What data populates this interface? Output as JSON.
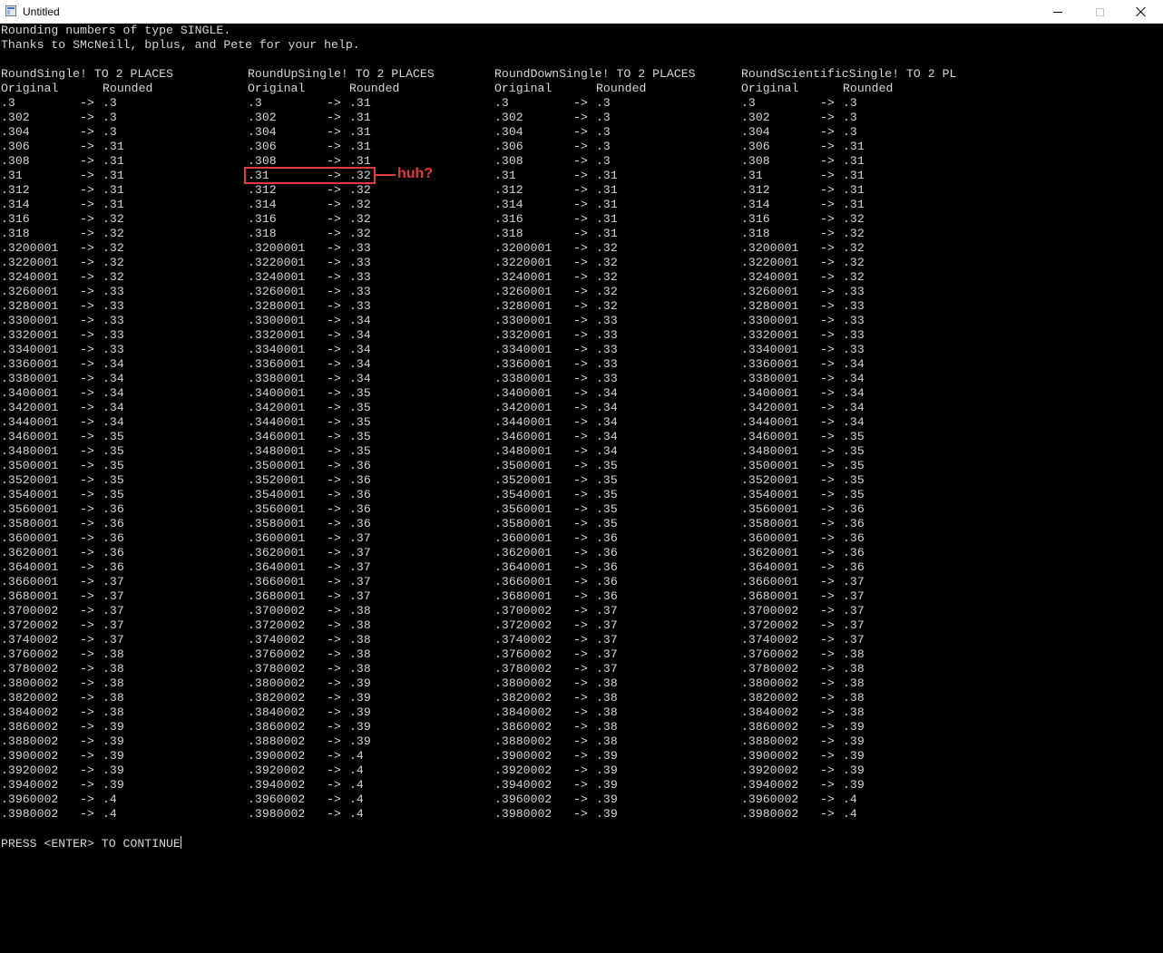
{
  "window": {
    "title": "Untitled"
  },
  "console": {
    "intro": [
      "Rounding numbers of type SINGLE.",
      "Thanks to SMcNeill, bplus, and Pete for your help."
    ],
    "columns": [
      {
        "header": "RoundSingle! TO 2 PLACES",
        "orig_label": "Original",
        "round_label": "Rounded",
        "rounded": [
          ".3",
          ".3",
          ".3",
          ".31",
          ".31",
          ".31",
          ".31",
          ".31",
          ".32",
          ".32",
          ".32",
          ".32",
          ".32",
          ".33",
          ".33",
          ".33",
          ".33",
          ".33",
          ".34",
          ".34",
          ".34",
          ".34",
          ".34",
          ".35",
          ".35",
          ".35",
          ".35",
          ".35",
          ".36",
          ".36",
          ".36",
          ".36",
          ".36",
          ".37",
          ".37",
          ".37",
          ".37",
          ".37",
          ".38",
          ".38",
          ".38",
          ".38",
          ".38",
          ".39",
          ".39",
          ".39",
          ".39",
          ".39",
          ".4",
          ".4"
        ]
      },
      {
        "header": "RoundUpSingle! TO 2 PLACES",
        "orig_label": "Original",
        "round_label": "Rounded",
        "rounded": [
          ".31",
          ".31",
          ".31",
          ".31",
          ".31",
          ".32",
          ".32",
          ".32",
          ".32",
          ".32",
          ".33",
          ".33",
          ".33",
          ".33",
          ".33",
          ".34",
          ".34",
          ".34",
          ".34",
          ".34",
          ".35",
          ".35",
          ".35",
          ".35",
          ".35",
          ".36",
          ".36",
          ".36",
          ".36",
          ".36",
          ".37",
          ".37",
          ".37",
          ".37",
          ".37",
          ".38",
          ".38",
          ".38",
          ".38",
          ".38",
          ".39",
          ".39",
          ".39",
          ".39",
          ".39",
          ".4",
          ".4",
          ".4",
          ".4",
          ".4"
        ]
      },
      {
        "header": "RoundDownSingle! TO 2 PLACES",
        "orig_label": "Original",
        "round_label": "Rounded",
        "rounded": [
          ".3",
          ".3",
          ".3",
          ".3",
          ".3",
          ".31",
          ".31",
          ".31",
          ".31",
          ".31",
          ".32",
          ".32",
          ".32",
          ".32",
          ".32",
          ".33",
          ".33",
          ".33",
          ".33",
          ".33",
          ".34",
          ".34",
          ".34",
          ".34",
          ".34",
          ".35",
          ".35",
          ".35",
          ".35",
          ".35",
          ".36",
          ".36",
          ".36",
          ".36",
          ".36",
          ".37",
          ".37",
          ".37",
          ".37",
          ".37",
          ".38",
          ".38",
          ".38",
          ".38",
          ".38",
          ".39",
          ".39",
          ".39",
          ".39",
          ".39"
        ]
      },
      {
        "header": "RoundScientificSingle! TO 2 PL",
        "orig_label": "Original",
        "round_label": "Rounded",
        "rounded": [
          ".3",
          ".3",
          ".3",
          ".31",
          ".31",
          ".31",
          ".31",
          ".31",
          ".32",
          ".32",
          ".32",
          ".32",
          ".32",
          ".33",
          ".33",
          ".33",
          ".33",
          ".33",
          ".34",
          ".34",
          ".34",
          ".34",
          ".34",
          ".35",
          ".35",
          ".35",
          ".35",
          ".35",
          ".36",
          ".36",
          ".36",
          ".36",
          ".36",
          ".37",
          ".37",
          ".37",
          ".37",
          ".37",
          ".38",
          ".38",
          ".38",
          ".38",
          ".38",
          ".39",
          ".39",
          ".39",
          ".39",
          ".39",
          ".4",
          ".4"
        ]
      }
    ],
    "originals": [
      ".3",
      ".302",
      ".304",
      ".306",
      ".308",
      ".31",
      ".312",
      ".314",
      ".316",
      ".318",
      ".3200001",
      ".3220001",
      ".3240001",
      ".3260001",
      ".3280001",
      ".3300001",
      ".3320001",
      ".3340001",
      ".3360001",
      ".3380001",
      ".3400001",
      ".3420001",
      ".3440001",
      ".3460001",
      ".3480001",
      ".3500001",
      ".3520001",
      ".3540001",
      ".3560001",
      ".3580001",
      ".3600001",
      ".3620001",
      ".3640001",
      ".3660001",
      ".3680001",
      ".3700002",
      ".3720002",
      ".3740002",
      ".3760002",
      ".3780002",
      ".3800002",
      ".3820002",
      ".3840002",
      ".3860002",
      ".3880002",
      ".3900002",
      ".3920002",
      ".3940002",
      ".3960002",
      ".3980002"
    ],
    "arrow": "->",
    "prompt": "PRESS <ENTER> TO CONTINUE"
  },
  "annotation": {
    "text": "huh?",
    "color": "#e23b3b"
  },
  "colors": {
    "console_bg": "#000000",
    "console_text": "#d6d6d6",
    "titlebar_bg": "#ffffff"
  }
}
